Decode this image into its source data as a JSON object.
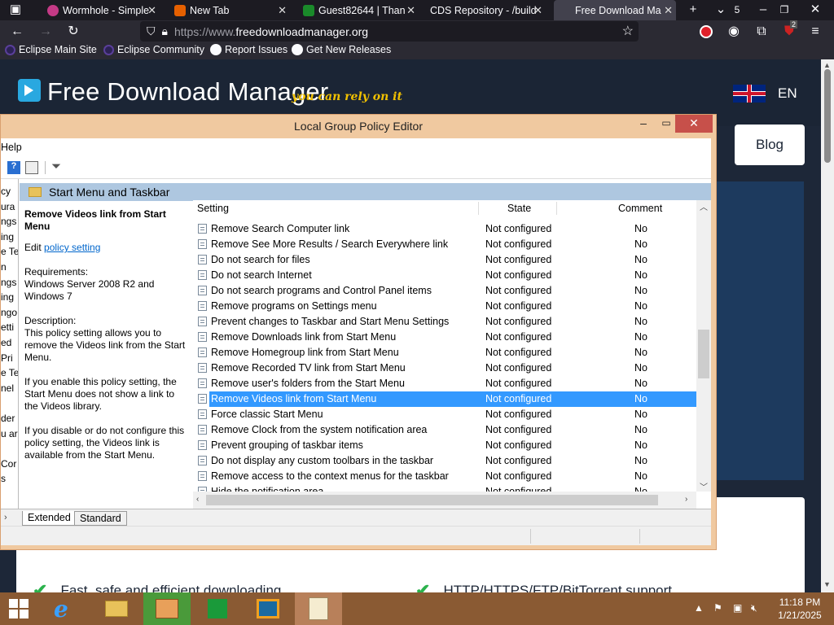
{
  "browser": {
    "tabs": [
      {
        "title": "Wormhole - Simple",
        "favicon_color": "#c43a86"
      },
      {
        "title": "New Tab",
        "favicon_color": "#e66000"
      },
      {
        "title": "Guest82644 | Than",
        "favicon_color": "#1a8a2a"
      },
      {
        "title": "CDS Repository - /build",
        "favicon_color": ""
      },
      {
        "title": "Free Download Ma",
        "favicon_color": "",
        "active": true
      }
    ],
    "tab_count_badge": "5",
    "url_scheme": "https://www.",
    "url_host": "freedownloadmanager.org",
    "extension_badge": "2",
    "bookmarks": [
      "Eclipse Main Site",
      "Eclipse Community",
      "Report Issues",
      "Get New Releases"
    ]
  },
  "website": {
    "brand_name": "Free Download Manager",
    "tagline": "you can rely on it",
    "language": "EN",
    "blog_label": "Blog",
    "features": [
      "Fast, safe and efficient downloading",
      "HTTP/HTTPS/FTP/BitTorrent support"
    ]
  },
  "gpedit": {
    "window_title": "Local Group Policy Editor",
    "menu_visible": "Help",
    "tree_fragments": [
      "cy",
      "ura",
      "ngs",
      "ing",
      "e Te",
      "n",
      "ngs",
      "ing",
      "ngo",
      "etti",
      "ed",
      "Pri",
      "e Te",
      "nel",
      "",
      "der",
      "u ar",
      "",
      "Cor",
      "s"
    ],
    "path_title": "Start Menu and Taskbar",
    "description": {
      "title": "Remove Videos link from Start Menu",
      "edit_prefix": "Edit",
      "edit_link": "policy setting",
      "requirements_label": "Requirements:",
      "requirements": "Windows Server 2008 R2 and Windows 7",
      "description_label": "Description:",
      "description": "This policy setting allows you to remove the Videos link from the Start Menu.",
      "enable_text": "If you enable this policy setting, the Start Menu does not show a link to the Videos library.",
      "disable_text": "If you disable or do not configure this policy setting, the Videos link is available from the Start Menu."
    },
    "columns": {
      "setting": "Setting",
      "state": "State",
      "comment": "Comment"
    },
    "rows": [
      {
        "name": "Remove Search Computer link",
        "state": "Not configured",
        "comment": "No"
      },
      {
        "name": "Remove See More Results / Search Everywhere link",
        "state": "Not configured",
        "comment": "No"
      },
      {
        "name": "Do not search for files",
        "state": "Not configured",
        "comment": "No"
      },
      {
        "name": "Do not search Internet",
        "state": "Not configured",
        "comment": "No"
      },
      {
        "name": "Do not search programs and Control Panel items",
        "state": "Not configured",
        "comment": "No"
      },
      {
        "name": "Remove programs on Settings menu",
        "state": "Not configured",
        "comment": "No"
      },
      {
        "name": "Prevent changes to Taskbar and Start Menu Settings",
        "state": "Not configured",
        "comment": "No"
      },
      {
        "name": "Remove Downloads link from Start Menu",
        "state": "Not configured",
        "comment": "No"
      },
      {
        "name": "Remove Homegroup link from Start Menu",
        "state": "Not configured",
        "comment": "No"
      },
      {
        "name": "Remove Recorded TV link from Start Menu",
        "state": "Not configured",
        "comment": "No"
      },
      {
        "name": "Remove user's folders from the Start Menu",
        "state": "Not configured",
        "comment": "No"
      },
      {
        "name": "Remove Videos link from Start Menu",
        "state": "Not configured",
        "comment": "No",
        "selected": true
      },
      {
        "name": "Force classic Start Menu",
        "state": "Not configured",
        "comment": "No"
      },
      {
        "name": "Remove Clock from the system notification area",
        "state": "Not configured",
        "comment": "No"
      },
      {
        "name": "Prevent grouping of taskbar items",
        "state": "Not configured",
        "comment": "No"
      },
      {
        "name": "Do not display any custom toolbars in the taskbar",
        "state": "Not configured",
        "comment": "No"
      },
      {
        "name": "Remove access to the context menus for the taskbar",
        "state": "Not configured",
        "comment": "No"
      },
      {
        "name": "Hide the notification area",
        "state": "Not configured",
        "comment": "No"
      }
    ],
    "view_tabs": [
      "Extended",
      "Standard"
    ]
  },
  "taskbar": {
    "time": "11:18 PM",
    "date": "1/21/2025"
  }
}
